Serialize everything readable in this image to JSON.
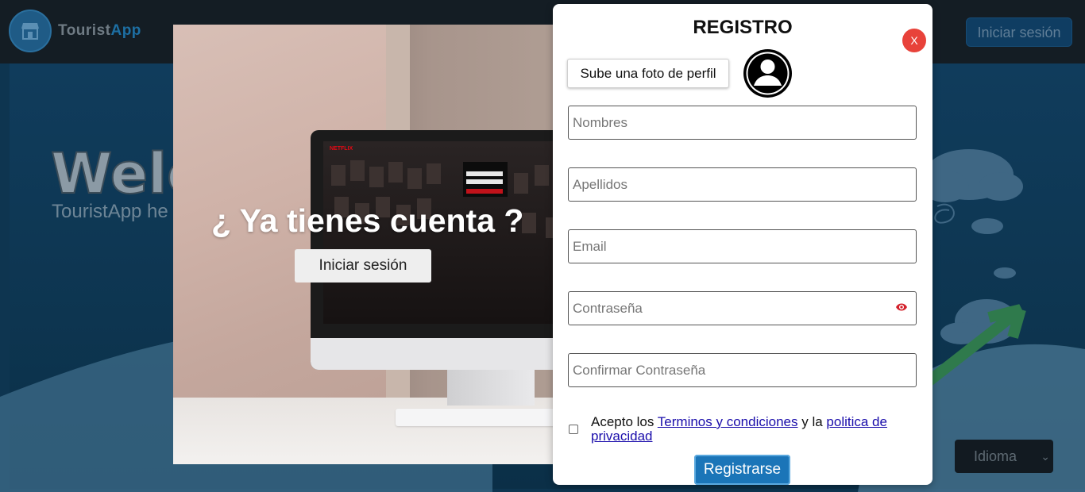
{
  "header": {
    "logo_text_1": "Tourist",
    "logo_text_2": "App",
    "login_label": "Iniciar sesión"
  },
  "hero": {
    "title": "Welco",
    "paragraph": "TouristApp he business estab a touristic des way about whi"
  },
  "language": {
    "selected": "Idioma"
  },
  "promo": {
    "title": "¿ Ya tienes cuenta ?",
    "login_button": "Iniciar sesión"
  },
  "register": {
    "title": "REGISTRO",
    "close_label": "X",
    "upload_label": "Sube una foto de perfil",
    "fields": {
      "first_name": "Nombres",
      "last_name": "Apellidos",
      "email": "Email",
      "password": "Contraseña",
      "confirm_password": "Confirmar Contraseña"
    },
    "terms": {
      "prefix": "Acepto los ",
      "terms_link": "Terminos y condiciones",
      "middle": " y la ",
      "privacy_link": "politica de privacidad"
    },
    "submit_label": "Registrarse"
  },
  "colors": {
    "accent": "#1b75b8",
    "close": "#e8423a",
    "eye_icon": "#d3202a"
  }
}
